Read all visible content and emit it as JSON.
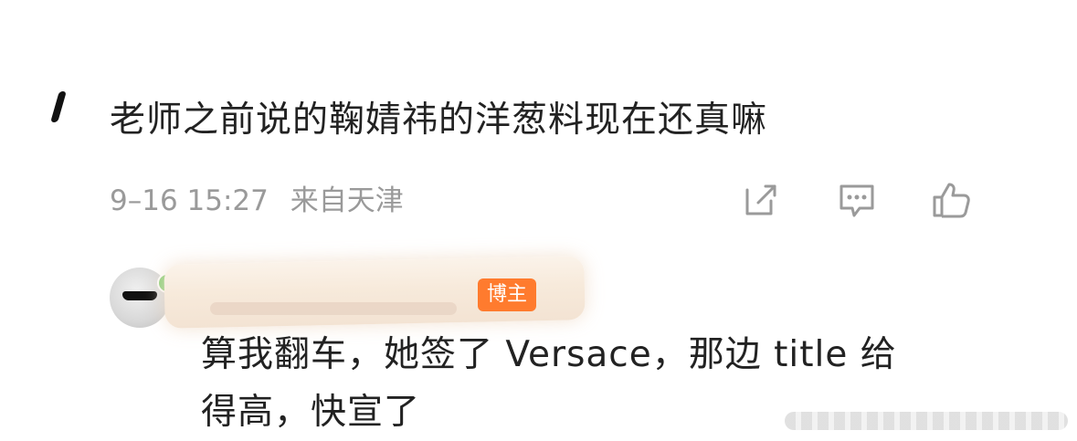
{
  "comment": {
    "text": "老师之前说的鞠婧祎的洋葱料现在还真嘛",
    "date_time": "9–16 15:27",
    "location": "来自天津",
    "actions": [
      {
        "icon": "share-icon"
      },
      {
        "icon": "comment-icon"
      },
      {
        "icon": "like-icon"
      }
    ]
  },
  "reply": {
    "badge": "博主",
    "text_lines": [
      "算我翻车，她签了 Versace，那边 title 给",
      "得高，快宣了"
    ]
  },
  "colors": {
    "text": "#222222",
    "meta": "#9a9a9a",
    "badge": "#ff7b2e",
    "redaction": "#f7eadb"
  }
}
